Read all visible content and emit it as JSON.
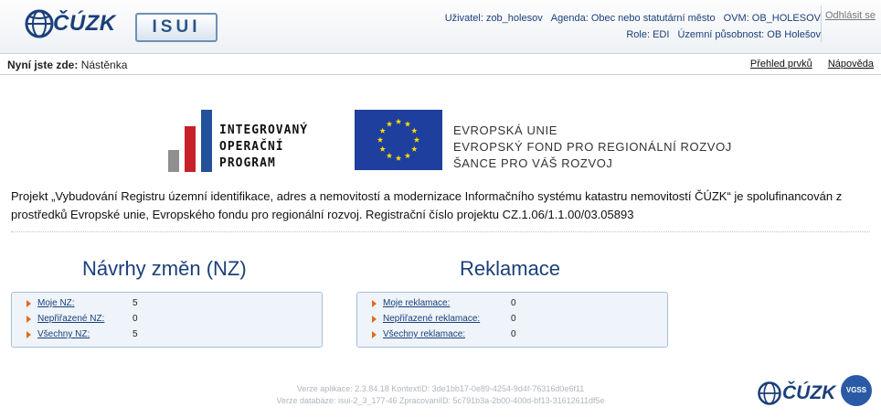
{
  "header": {
    "logo_text": "ČÚZK",
    "isui_text": "ISUI",
    "user": "Uživatel: zob_holesov",
    "agenda": "Agenda: Obec nebo statutární město",
    "ovm": "OVM: OB_HOLESOV",
    "role": "Role: EDI",
    "scope": "Územní působnost: OB Holešov",
    "logout": "Odhlásit se"
  },
  "breadcrumb": {
    "label": "Nyní jste zde:",
    "current": "Nástěnka"
  },
  "nav": {
    "overview": "Přehled prvků",
    "help": "Nápověda"
  },
  "logos": {
    "iop": [
      "INTEGROVANÝ",
      "OPERAČNÍ",
      "PROGRAM"
    ],
    "eu": [
      "EVROPSKÁ UNIE",
      "EVROPSKÝ FOND PRO REGIONÁLNÍ ROZVOJ",
      "ŠANCE PRO VÁŠ ROZVOJ"
    ],
    "iop_colors": [
      "#8f8f8f",
      "#c8202a",
      "#23519c"
    ],
    "eu_flag_color": "#1e3f9e",
    "eu_star_color": "#ffdd00"
  },
  "project_text": "Projekt „Vybudování Registru územní identifikace, adres a nemovitostí a modernizace Informačního systému katastru nemovitostí ČÚZK“ je spolufinancován z prostředků Evropské unie, Evropského fondu pro regionální rozvoj. Registrační číslo projektu CZ.1.06/1.1.00/03.05893",
  "nz": {
    "title": "Návrhy změn (NZ)",
    "items": [
      {
        "label": "Moje NZ:",
        "value": "5"
      },
      {
        "label": "Nepřiřazené NZ:",
        "value": "0"
      },
      {
        "label": "Všechny NZ:",
        "value": "5"
      }
    ]
  },
  "claims": {
    "title": "Reklamace",
    "items": [
      {
        "label": "Moje reklamace:",
        "value": "0"
      },
      {
        "label": "Nepřiřazené reklamace:",
        "value": "0"
      },
      {
        "label": "Všechny reklamace:",
        "value": "0"
      }
    ]
  },
  "footer": {
    "line1": "Verze aplikace: 2.3.84.18 KontextID: 3de1bb17-0e89-4254-9d4f-76316d0e6f11",
    "line2": "Verze databáze: isui-2_3_177-46 ZpracovaniID: 5c791b3a-2b00-400d-bf13-31612611df5e",
    "logo_text": "ČÚZK",
    "vgs_text": "VGSS"
  }
}
